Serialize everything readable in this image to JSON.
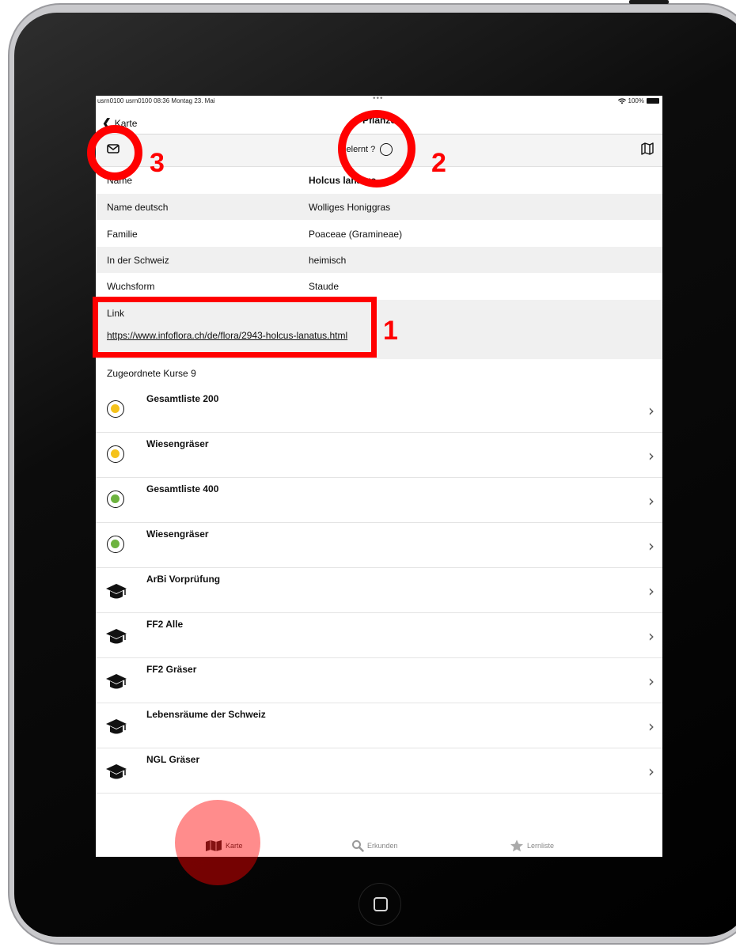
{
  "status_bar": {
    "left": "usrn0100 usrn0100  08:36  Montag 23. Mai",
    "dots": "•••",
    "battery": "100%"
  },
  "nav": {
    "back_label": "Karte",
    "title": "Pflanze"
  },
  "toolbar": {
    "gelernt_label": "Gelernt ?"
  },
  "info_rows": [
    {
      "label": "Name",
      "value": "Holcus lanatus"
    },
    {
      "label": "Name deutsch",
      "value": "Wolliges Honiggras"
    },
    {
      "label": "Familie",
      "value": "Poaceae (Gramineae)"
    },
    {
      "label": "In der Schweiz",
      "value": "heimisch"
    },
    {
      "label": "Wuchsform",
      "value": "Staude"
    }
  ],
  "link": {
    "label": "Link",
    "url": "https://www.infoflora.ch/de/flora/2943-holcus-lanatus.html"
  },
  "courses_title": "Zugeordnete Kurse 9",
  "courses": [
    {
      "name": "Gesamtliste 200",
      "icon": "status-dot-icon",
      "dot_color": "#f5c21b"
    },
    {
      "name": "Wiesengräser",
      "icon": "status-dot-icon",
      "dot_color": "#f5c21b"
    },
    {
      "name": "Gesamtliste 400",
      "icon": "status-dot-icon",
      "dot_color": "#6db33f"
    },
    {
      "name": "Wiesengräser",
      "icon": "status-dot-icon",
      "dot_color": "#6db33f"
    },
    {
      "name": "ArBi Vorprüfung",
      "icon": "graduation-cap-icon"
    },
    {
      "name": "FF2 Alle",
      "icon": "graduation-cap-icon"
    },
    {
      "name": "FF2 Gräser",
      "icon": "graduation-cap-icon"
    },
    {
      "name": "Lebensräume der Schweiz",
      "icon": "graduation-cap-icon"
    },
    {
      "name": "NGL Gräser",
      "icon": "graduation-cap-icon"
    }
  ],
  "tabs": [
    {
      "label": "Karte",
      "icon": "map-icon"
    },
    {
      "label": "Erkunden",
      "icon": "search-icon"
    },
    {
      "label": "Lernliste",
      "icon": "star-icon"
    }
  ],
  "annotations": {
    "one": "1",
    "two": "2",
    "three": "3"
  },
  "colors": {
    "annotation": "#ff0000",
    "dot_yellow": "#f5c21b",
    "dot_green": "#6db33f"
  }
}
